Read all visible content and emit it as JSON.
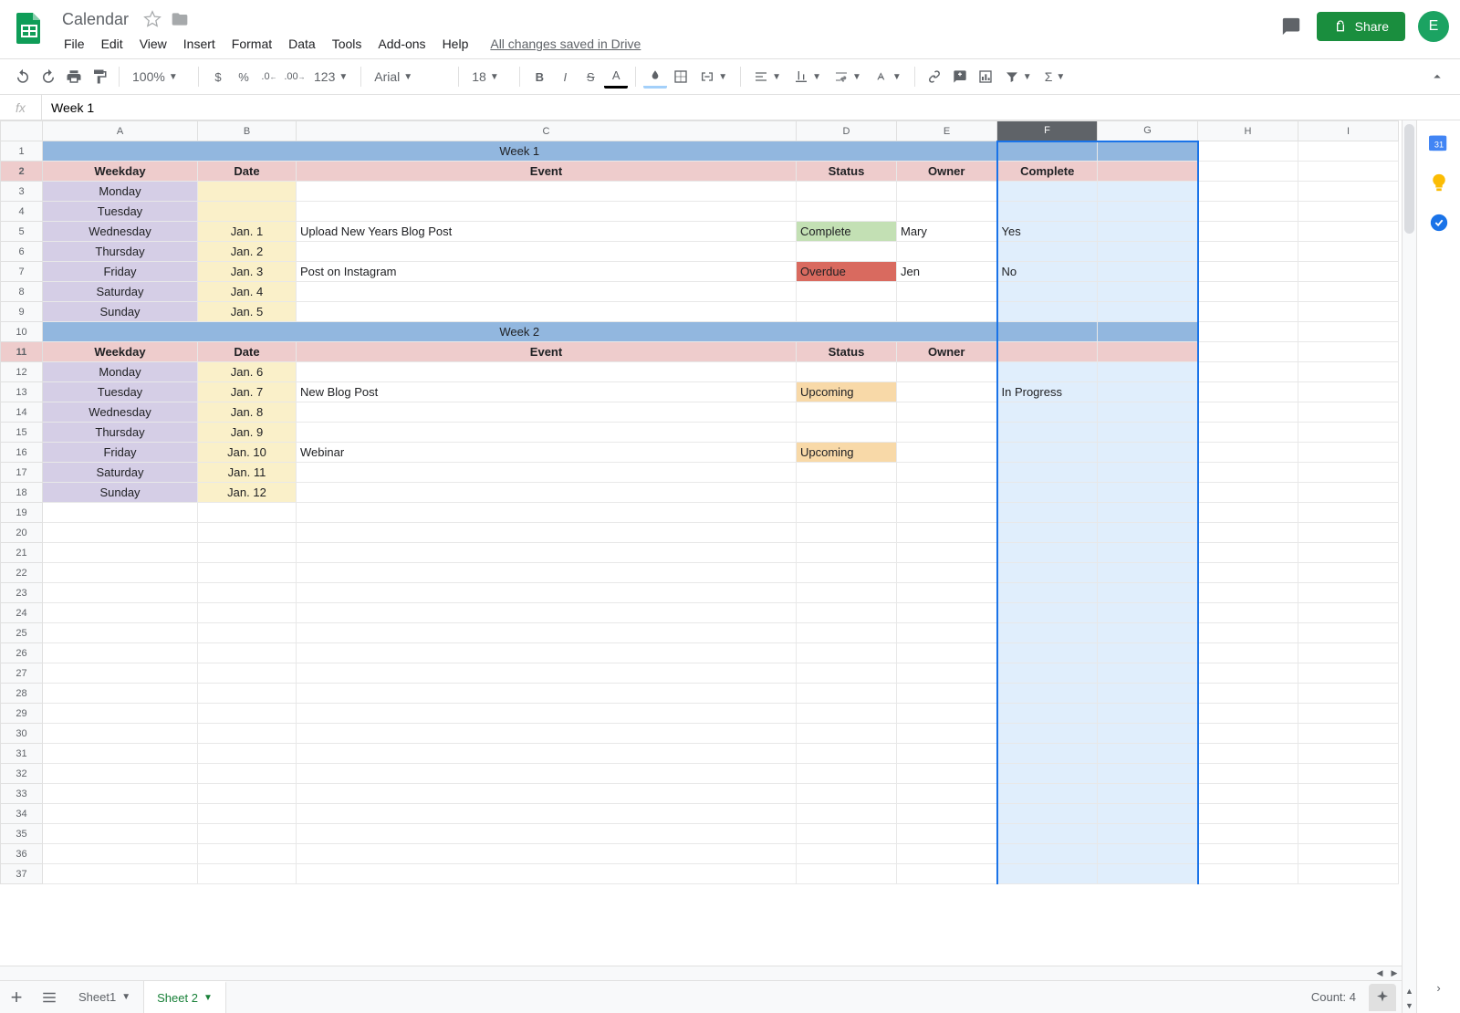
{
  "doc_title": "Calendar",
  "menus": [
    "File",
    "Edit",
    "View",
    "Insert",
    "Format",
    "Data",
    "Tools",
    "Add-ons",
    "Help"
  ],
  "drive_status": "All changes saved in Drive",
  "share_label": "Share",
  "avatar_initial": "E",
  "toolbar": {
    "zoom": "100%",
    "format_num": "123",
    "font": "Arial",
    "font_size": "18"
  },
  "formula_value": "Week 1",
  "columns": [
    "A",
    "B",
    "C",
    "D",
    "E",
    "F",
    "G",
    "H",
    "I"
  ],
  "selected_column": "F",
  "row_count": 37,
  "spreadsheet": {
    "weeks": [
      {
        "title": "Week 1",
        "headers": [
          "Weekday",
          "Date",
          "Event",
          "Status",
          "Owner",
          "Complete"
        ],
        "rows": [
          {
            "weekday": "Monday",
            "date": "",
            "event": "",
            "status": "",
            "owner": "",
            "complete": ""
          },
          {
            "weekday": "Tuesday",
            "date": "",
            "event": "",
            "status": "",
            "owner": "",
            "complete": ""
          },
          {
            "weekday": "Wednesday",
            "date": "Jan. 1",
            "event": "Upload New Years Blog Post",
            "status": "Complete",
            "owner": "Mary",
            "complete": "Yes"
          },
          {
            "weekday": "Thursday",
            "date": "Jan. 2",
            "event": "",
            "status": "",
            "owner": "",
            "complete": ""
          },
          {
            "weekday": "Friday",
            "date": "Jan. 3",
            "event": "Post on Instagram",
            "status": "Overdue",
            "owner": "Jen",
            "complete": "No"
          },
          {
            "weekday": "Saturday",
            "date": "Jan. 4",
            "event": "",
            "status": "",
            "owner": "",
            "complete": ""
          },
          {
            "weekday": "Sunday",
            "date": "Jan. 5",
            "event": "",
            "status": "",
            "owner": "",
            "complete": ""
          }
        ]
      },
      {
        "title": "Week 2",
        "headers": [
          "Weekday",
          "Date",
          "Event",
          "Status",
          "Owner",
          ""
        ],
        "rows": [
          {
            "weekday": "Monday",
            "date": "Jan. 6",
            "event": "",
            "status": "",
            "owner": "",
            "complete": ""
          },
          {
            "weekday": "Tuesday",
            "date": "Jan. 7",
            "event": "New Blog Post",
            "status": "Upcoming",
            "owner": "",
            "complete": "In Progress"
          },
          {
            "weekday": "Wednesday",
            "date": "Jan. 8",
            "event": "",
            "status": "",
            "owner": "",
            "complete": ""
          },
          {
            "weekday": "Thursday",
            "date": "Jan. 9",
            "event": "",
            "status": "",
            "owner": "",
            "complete": ""
          },
          {
            "weekday": "Friday",
            "date": "Jan. 10",
            "event": "Webinar",
            "status": "Upcoming",
            "owner": "",
            "complete": ""
          },
          {
            "weekday": "Saturday",
            "date": "Jan. 11",
            "event": "",
            "status": "",
            "owner": "",
            "complete": ""
          },
          {
            "weekday": "Sunday",
            "date": "Jan. 12",
            "event": "",
            "status": "",
            "owner": "",
            "complete": ""
          }
        ]
      }
    ]
  },
  "sheet_tabs": [
    {
      "name": "Sheet1",
      "active": false
    },
    {
      "name": "Sheet 2",
      "active": true
    }
  ],
  "count_label": "Count: 4",
  "colors": {
    "week_title": "#92b7df",
    "header_row": "#eecccc",
    "weekday": "#d5cee6",
    "date": "#faf0c9",
    "complete": "#c3e0b4",
    "overdue": "#d96a5f",
    "upcoming": "#f8d9a8",
    "selection": "#e0eefc"
  }
}
